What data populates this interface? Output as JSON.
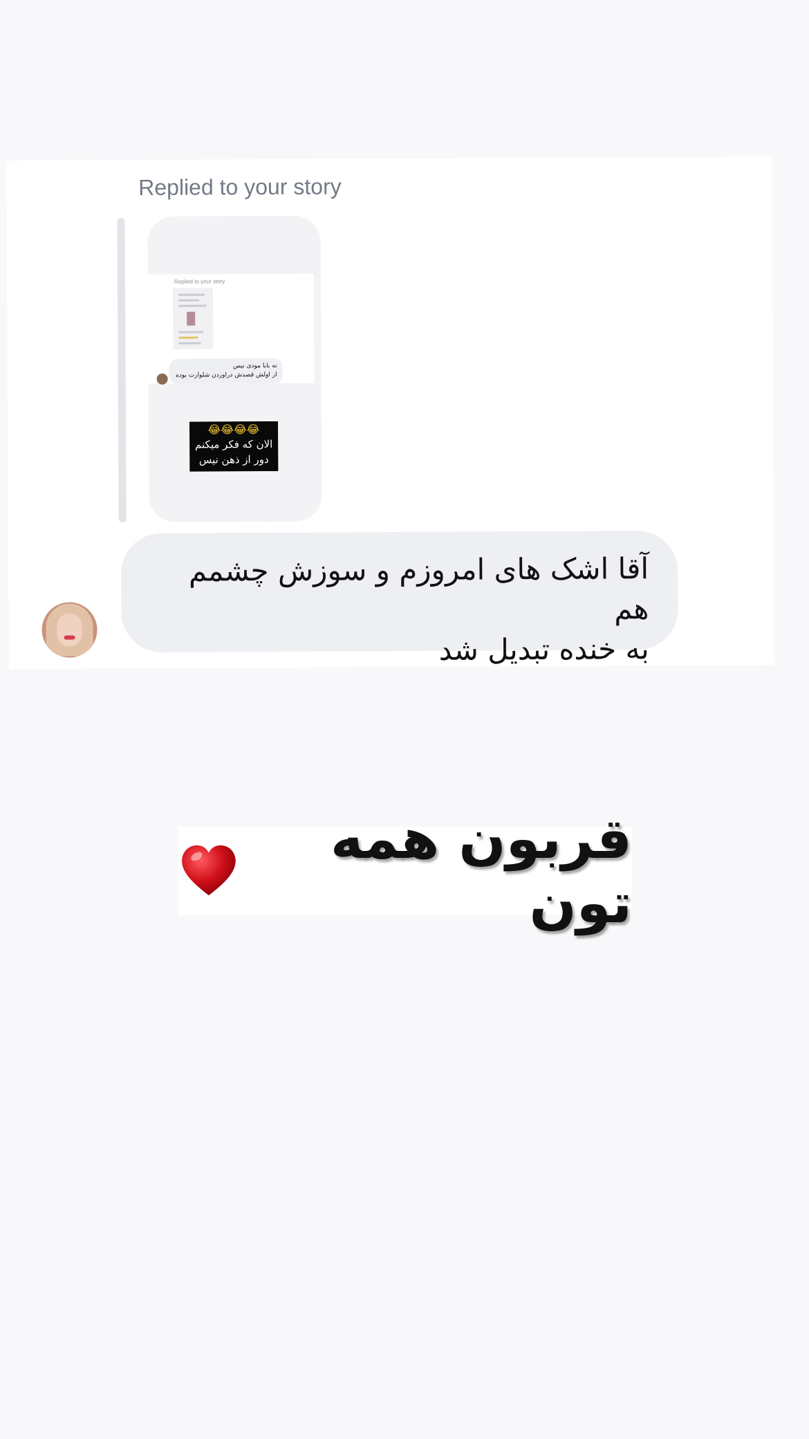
{
  "reply": {
    "label": "Replied to your story"
  },
  "story_preview": {
    "mini_label": "Replied to your story",
    "mini_message_lines": [
      "نه بابا مودی نیس",
      "از اولش قصدش دراوردن شلوارت بوده"
    ],
    "meme_emoji": "😂😂😂😂",
    "meme_lines": [
      "الان که فکر میکنم",
      "دور از ذهن نیس"
    ]
  },
  "message": {
    "line1": "آقا اشک های امروزم  و سوزش چشمم هم",
    "line2": "به خنده تبدیل شد"
  },
  "sticker": {
    "text": "قربون همه تون"
  },
  "colors": {
    "page_background": "#f8f8fa",
    "bubble_background": "#eeeff3",
    "reply_label": "#737a85",
    "heart": "#d0101a"
  },
  "icons": {
    "sticker_icon": "red-heart-icon"
  }
}
